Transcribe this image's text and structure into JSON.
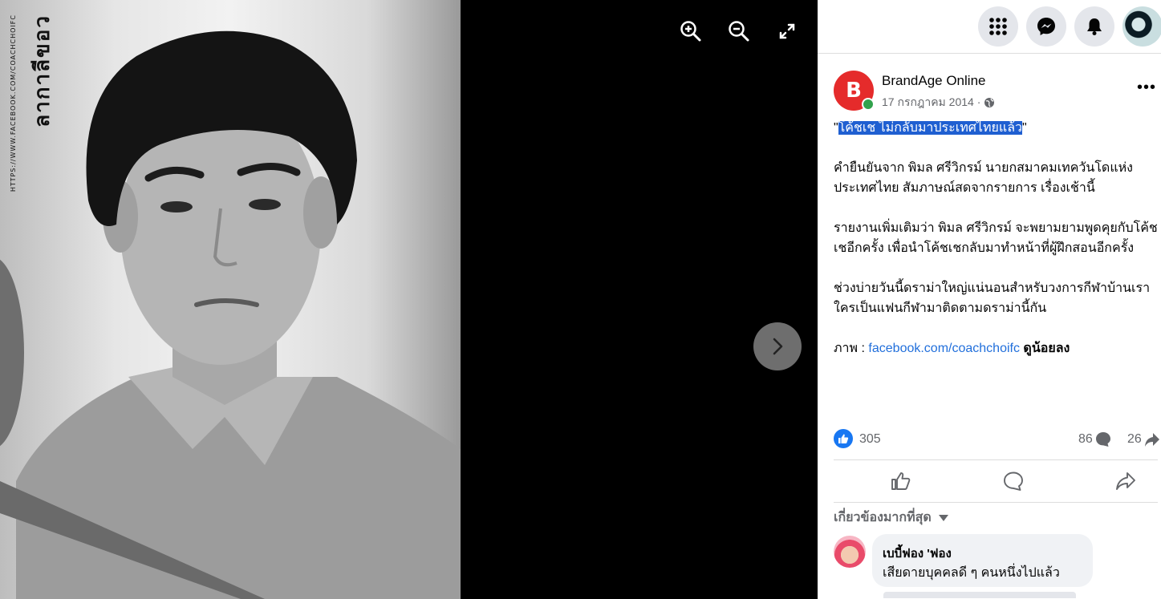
{
  "viewer": {
    "watermark_main": "ลากาลีขอว",
    "watermark_url": "HTTPS://WWW.FACEBOOK.COM/COACHCHOIFC",
    "zoom_in_icon": "zoom-in-icon",
    "zoom_out_icon": "zoom-out-icon",
    "fullscreen_icon": "fullscreen-icon",
    "next_icon": "chevron-right-icon"
  },
  "topbar": {
    "icons": [
      "apps-grid-icon",
      "messenger-icon",
      "bell-icon",
      "profile-avatar"
    ]
  },
  "post": {
    "page_name": "BrandAge Online",
    "page_avatar_letter": "B",
    "date": "17 กรกฎาคม 2014 ·",
    "privacy_icon": "globe-icon",
    "more_label": "•••",
    "title_quote_open": "\"",
    "title": "โค้ชเช ไม่กลับมาประเทศไทยแล้ว",
    "title_quote_close": "\"",
    "para1": "คำยืนยันจาก พิมล ศรีวิกรม์ นายกสมาคมเทควันโดแห่งประเทศไทย สัมภาษณ์สดจากรายการ เรื่องเช้านี้",
    "para2": "รายงานเพิ่มเติมว่า พิมล ศรีวิกรม์ จะพยามยามพูดคุยกับโค้ชเชอีกครั้ง เพื่อนำโค้ชเชกลับมาทำหน้าที่ผู้ฝึกสอนอีกครั้ง",
    "para3": "ช่วงบ่ายวันนี้ดราม่าใหญ่แน่นอนสำหรับวงการกีฬาบ้านเรา ใครเป็นแฟนกีฬามาติดตามดราม่านี้กัน",
    "photo_label": "ภาพ : ",
    "photo_link": "facebook.com/coachchoifc",
    "see_less": "ดูน้อยลง"
  },
  "stats": {
    "likes": "305",
    "comments": "86",
    "shares": "26"
  },
  "comments_section": {
    "sort_label": "เกี่ยวข้องมากที่สุด",
    "comment_author": "เบบี้ฟอง 'ฟอง",
    "comment_text": "เสียดายบุคคลดี ๆ คนหนึ่งไปแล้ว"
  },
  "colors": {
    "accent": "#1877f2",
    "brand_red": "#e52b2b",
    "highlight": "#1f5fd1"
  }
}
